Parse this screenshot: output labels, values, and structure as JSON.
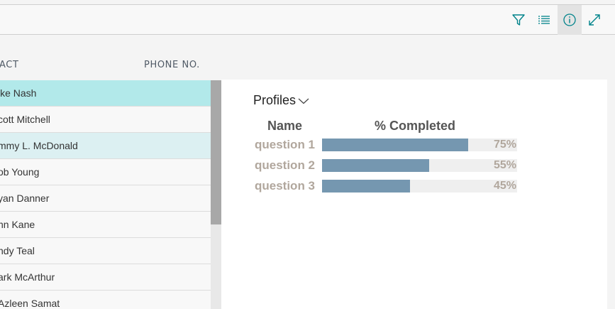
{
  "toolbar": {
    "icons": [
      "filter-icon",
      "list-view-icon",
      "info-icon",
      "expand-icon"
    ],
    "accent": "#00838a"
  },
  "columns": {
    "contact": "ACT",
    "phone": "PHONE NO."
  },
  "rows": [
    {
      "name": "ike Nash",
      "state": "selected"
    },
    {
      "name": "cott Mitchell",
      "state": "normal"
    },
    {
      "name": "mmy L. McDonald",
      "state": "highlight"
    },
    {
      "name": "ob Young",
      "state": "normal"
    },
    {
      "name": "yan Danner",
      "state": "normal"
    },
    {
      "name": "hn Kane",
      "state": "normal"
    },
    {
      "name": "ndy Teal",
      "state": "normal"
    },
    {
      "name": "ark McArthur",
      "state": "normal"
    },
    {
      "name": "Azleen Samat",
      "state": "normal"
    }
  ],
  "factbox": {
    "title": "Profiles",
    "header_name": "Name",
    "header_completed": "% Completed",
    "items": [
      {
        "label": "question 1",
        "percent_text": "75%",
        "percent": 75
      },
      {
        "label": "question 2",
        "percent_text": "55%",
        "percent": 55
      },
      {
        "label": "question 3",
        "percent_text": "45%",
        "percent": 45
      }
    ],
    "bar_color": "#7597b0",
    "bar_bg_color": "#efefef"
  }
}
